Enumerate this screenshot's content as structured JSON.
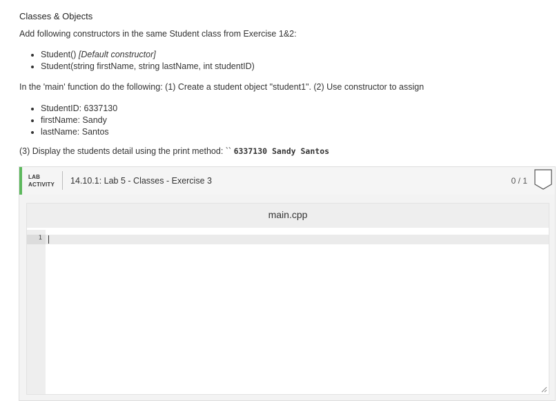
{
  "problem": {
    "heading": "Classes & Objects",
    "intro": "Add following constructors in the same Student class from Exercise 1&2:",
    "constructors": [
      {
        "text": "Student() ",
        "note": "[Default constructor]"
      },
      {
        "text": "Student(string firstName, string lastName, int studentID)",
        "note": ""
      }
    ],
    "main_instructions": "In the 'main' function do the following: (1) Create a student object \"student1\". (2) Use constructor to assign",
    "fields": [
      "StudentID: 6337130",
      "firstName: Sandy",
      "lastName: Santos"
    ],
    "display_instruction": "(3) Display the students detail using the print method: `` ",
    "display_output": "6337130 Sandy Santos"
  },
  "lab": {
    "tag_line1": "LAB",
    "tag_line2": "ACTIVITY",
    "title": "14.10.1: Lab 5 - Classes - Exercise 3",
    "score": "0 / 1",
    "accent_color": "#5cb85c"
  },
  "editor": {
    "file_name": "main.cpp",
    "line_number": "1",
    "code": ""
  }
}
